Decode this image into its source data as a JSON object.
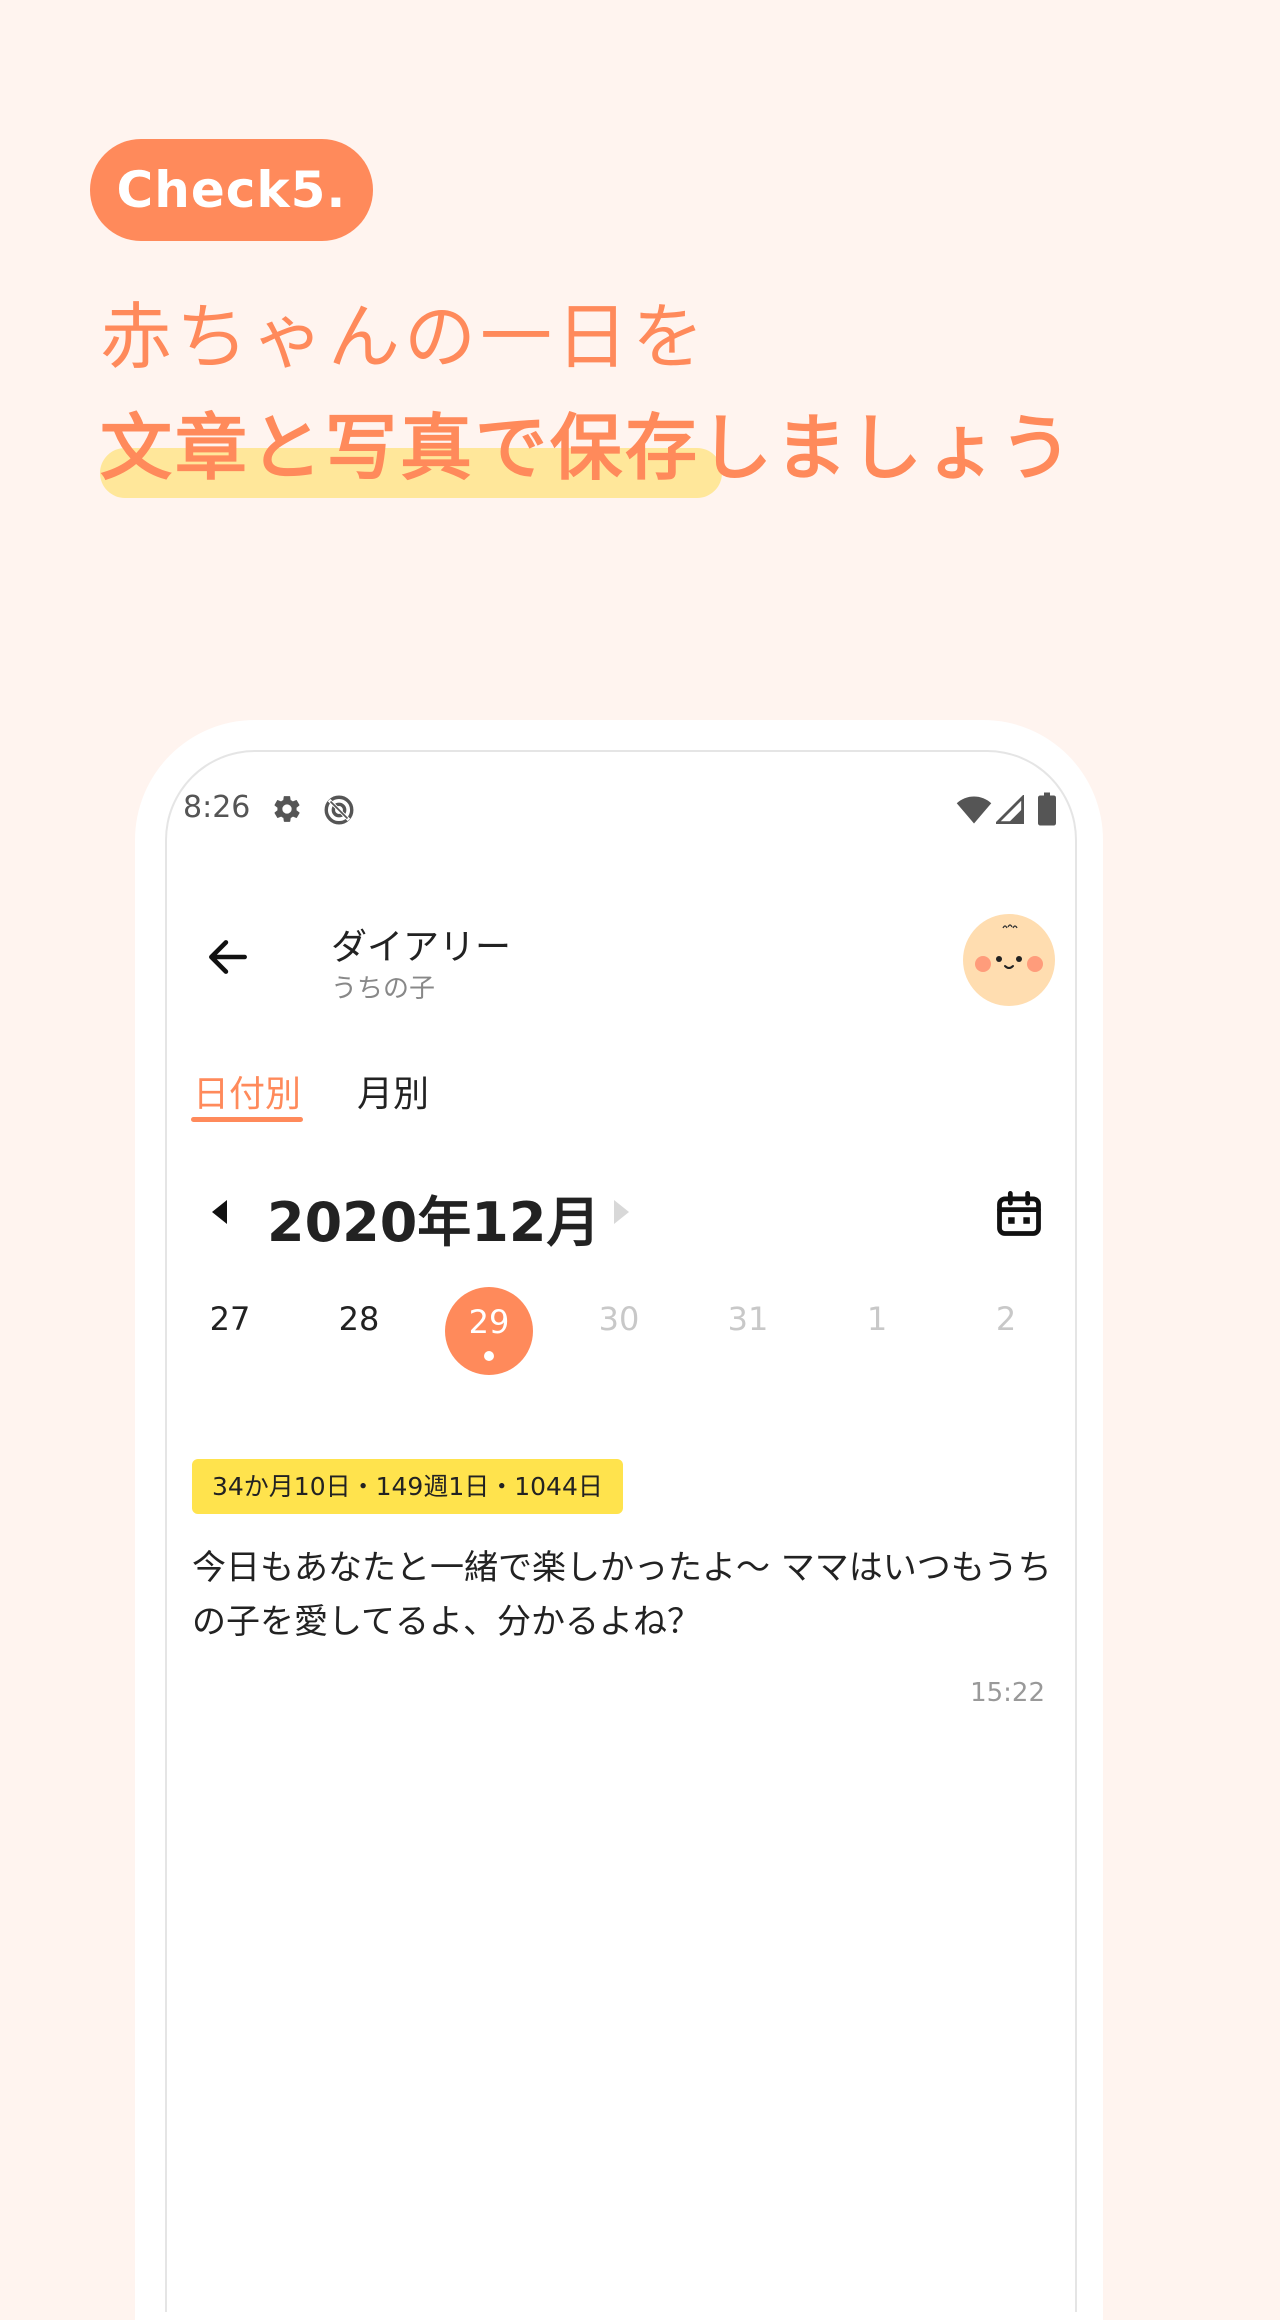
{
  "hero": {
    "badge": "Check5.",
    "line1": "赤ちゃんの一日を",
    "line2": "文章と写真で保存しましょう"
  },
  "status_bar": {
    "time": "8:26",
    "left_icons": [
      "gear-icon",
      "sync-icon"
    ],
    "right_icons": [
      "wifi-icon",
      "signal-icon",
      "battery-icon"
    ]
  },
  "header": {
    "title": "ダイアリー",
    "subtitle": "うちの子"
  },
  "tabs": [
    {
      "label": "日付別",
      "active": true
    },
    {
      "label": "月別",
      "active": false
    }
  ],
  "calendar": {
    "month": "2020年12月",
    "days": [
      {
        "label": "27",
        "state": "past"
      },
      {
        "label": "28",
        "state": "past"
      },
      {
        "label": "29",
        "state": "selected",
        "has_entry": true
      },
      {
        "label": "30",
        "state": "future"
      },
      {
        "label": "31",
        "state": "future"
      },
      {
        "label": "1",
        "state": "future"
      },
      {
        "label": "2",
        "state": "future"
      }
    ]
  },
  "entry": {
    "age": "34か月10日・149週1日・1044日",
    "text": "今日もあなたと一緒で楽しかったよ〜 ママはいつもうちの子を愛してるよ、分かるよね？",
    "time": "15:22"
  },
  "colors": {
    "background": "#FFF4EF",
    "accent": "#FF8A5B",
    "highlight": "#FFE79A",
    "age_badge": "#FFE34D",
    "text": "#222222",
    "muted": "#999999"
  }
}
